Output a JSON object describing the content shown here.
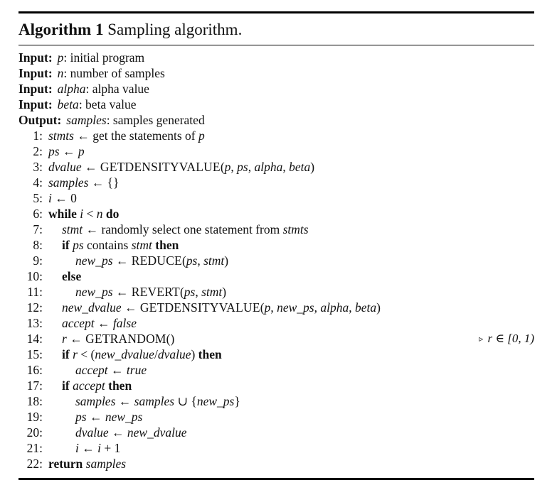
{
  "algorithm": {
    "label": "Algorithm 1",
    "caption": "Sampling algorithm.",
    "io": [
      {
        "label": "Input:",
        "var": "p",
        "rest": ": initial program"
      },
      {
        "label": "Input:",
        "var": "n",
        "rest": ": number of samples"
      },
      {
        "label": "Input:",
        "var": "alpha",
        "rest": ": alpha value"
      },
      {
        "label": "Input:",
        "var": "beta",
        "rest": ": beta value"
      },
      {
        "label": "Output:",
        "var": "samples",
        "rest": ": samples generated"
      }
    ],
    "lines": [
      {
        "n": "1:",
        "indent": 0,
        "text": "stmts ← get the statements of p"
      },
      {
        "n": "2:",
        "indent": 0,
        "text": "ps ← p"
      },
      {
        "n": "3:",
        "indent": 0,
        "text": "dvalue ← GetDensityValue(p, ps, alpha, beta)"
      },
      {
        "n": "4:",
        "indent": 0,
        "text": "samples ← {}"
      },
      {
        "n": "5:",
        "indent": 0,
        "text": "i ← 0"
      },
      {
        "n": "6:",
        "indent": 0,
        "text": "while i < n do"
      },
      {
        "n": "7:",
        "indent": 1,
        "text": "stmt ← randomly select one statement from stmts"
      },
      {
        "n": "8:",
        "indent": 1,
        "text": "if ps contains stmt then"
      },
      {
        "n": "9:",
        "indent": 2,
        "text": "new_ps ← Reduce(ps, stmt)"
      },
      {
        "n": "10:",
        "indent": 1,
        "text": "else"
      },
      {
        "n": "11:",
        "indent": 2,
        "text": "new_ps ← Revert(ps, stmt)"
      },
      {
        "n": "12:",
        "indent": 1,
        "text": "new_dvalue ← GetDensityValue(p, new_ps, alpha, beta)"
      },
      {
        "n": "13:",
        "indent": 1,
        "text": "accept ← false"
      },
      {
        "n": "14:",
        "indent": 1,
        "text": "r ← GetRandom()",
        "comment": "▹ r ∈ [0, 1)"
      },
      {
        "n": "15:",
        "indent": 1,
        "text": "if r < (new_dvalue/dvalue) then"
      },
      {
        "n": "16:",
        "indent": 2,
        "text": "accept ← true"
      },
      {
        "n": "17:",
        "indent": 1,
        "text": "if accept then"
      },
      {
        "n": "18:",
        "indent": 2,
        "text": "samples ← samples ∪ {new_ps}"
      },
      {
        "n": "19:",
        "indent": 2,
        "text": "ps ← new_ps"
      },
      {
        "n": "20:",
        "indent": 2,
        "text": "dvalue ← new_dvalue"
      },
      {
        "n": "21:",
        "indent": 2,
        "text": "i ← i + 1"
      },
      {
        "n": "22:",
        "indent": 0,
        "text": "return samples"
      }
    ]
  }
}
